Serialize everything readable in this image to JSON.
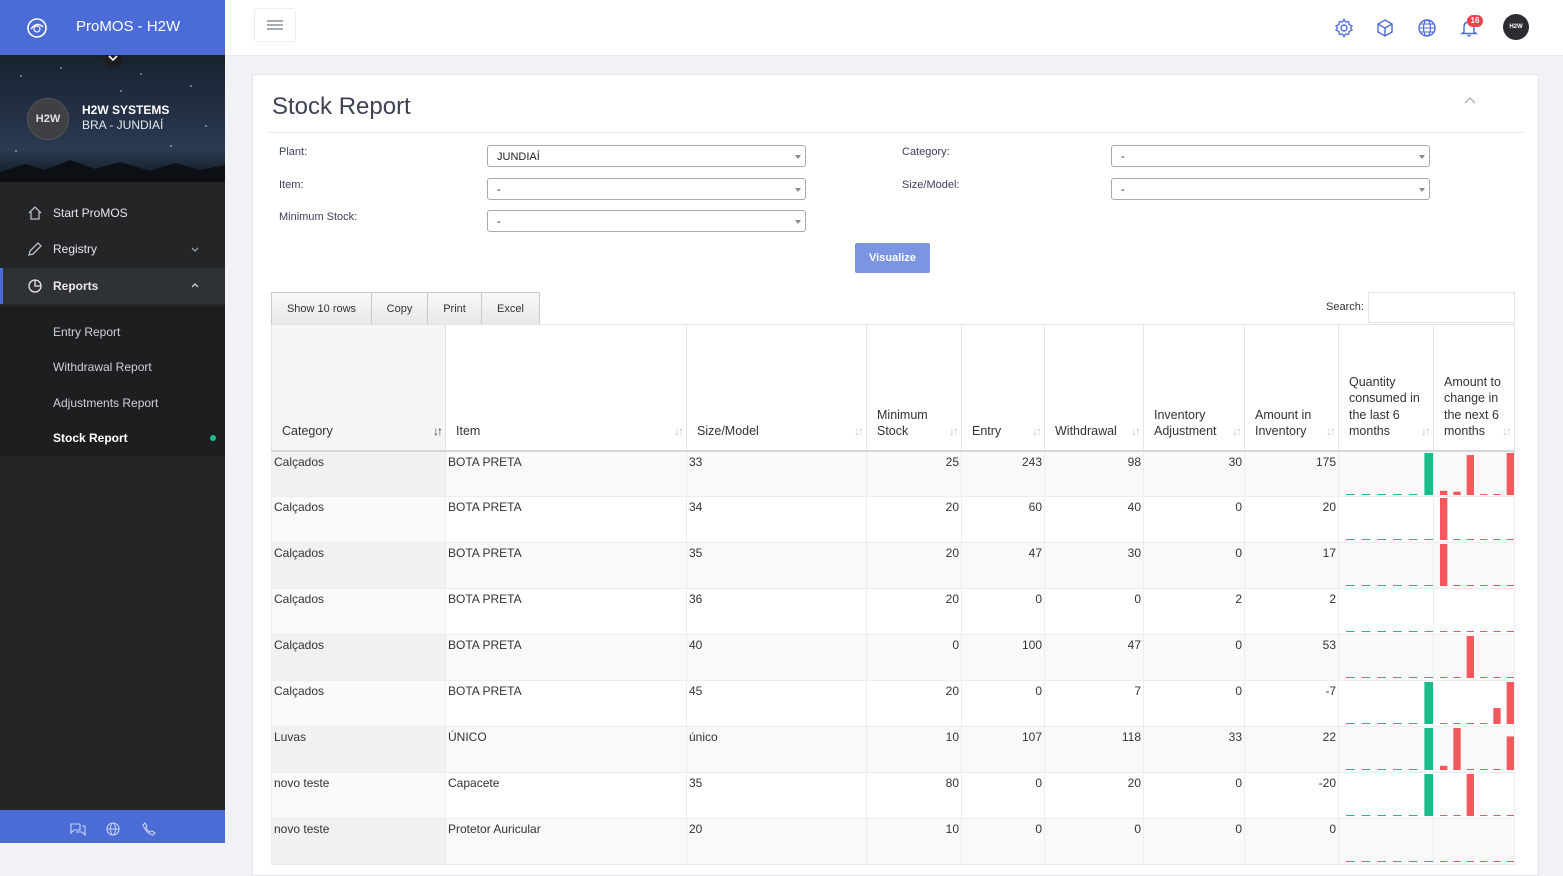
{
  "app": {
    "title": "ProMOS - H2W"
  },
  "profile": {
    "avatar": "H2W",
    "name": "H2W SYSTEMS",
    "location": "BRA - JUNDIAÍ"
  },
  "nav": {
    "start": "Start ProMOS",
    "registry": "Registry",
    "reports": "Reports",
    "submenu": [
      "Entry Report",
      "Withdrawal Report",
      "Adjustments Report",
      "Stock Report"
    ]
  },
  "topbar": {
    "notifications": "16",
    "avatar": "H2W"
  },
  "page": {
    "title": "Stock Report"
  },
  "filters": {
    "plant_label": "Plant:",
    "plant_value": "JUNDIAÍ",
    "category_label": "Category:",
    "category_value": "-",
    "item_label": "Item:",
    "item_value": "-",
    "size_label": "Size/Model:",
    "size_value": "-",
    "minstock_label": "Minimum Stock:",
    "minstock_value": "-",
    "visualize": "Visualize"
  },
  "toolbar": {
    "show_rows": "Show 10 rows",
    "copy": "Copy",
    "print": "Print",
    "excel": "Excel",
    "search_label": "Search:",
    "search_value": ""
  },
  "table": {
    "headers": [
      "Category",
      "Item",
      "Size/Model",
      "Minimum Stock",
      "Entry",
      "Withdrawal",
      "Inventory Adjustment",
      "Amount in Inventory",
      "Quantity consumed in the last 6 months",
      "Amount to change in the next 6 months"
    ],
    "rows": [
      [
        "Calçados",
        "BOTA PRETA",
        "33",
        "25",
        "243",
        "98",
        "30",
        "175"
      ],
      [
        "Calçados",
        "BOTA PRETA",
        "34",
        "20",
        "60",
        "40",
        "0",
        "20"
      ],
      [
        "Calçados",
        "BOTA PRETA",
        "35",
        "20",
        "47",
        "30",
        "0",
        "17"
      ],
      [
        "Calçados",
        "BOTA PRETA",
        "36",
        "20",
        "0",
        "0",
        "2",
        "2"
      ],
      [
        "Calçados",
        "BOTA PRETA",
        "40",
        "0",
        "100",
        "47",
        "0",
        "53"
      ],
      [
        "Calçados",
        "BOTA PRETA",
        "45",
        "20",
        "0",
        "7",
        "0",
        "-7"
      ],
      [
        "Luvas",
        "ÚNICO",
        "único",
        "10",
        "107",
        "118",
        "33",
        "22"
      ],
      [
        "novo teste",
        "Capacete",
        "35",
        "80",
        "0",
        "20",
        "0",
        "-20"
      ],
      [
        "novo teste",
        "Protetor Auricular",
        "20",
        "10",
        "0",
        "0",
        "0",
        "0"
      ]
    ],
    "consumed_sparklines": [
      [
        0,
        0,
        0,
        0,
        0,
        1
      ],
      [
        0,
        0,
        0,
        0,
        0,
        0
      ],
      [
        0,
        0,
        0,
        0,
        0,
        0
      ],
      [
        0,
        0,
        0,
        0,
        0,
        0
      ],
      [
        0,
        0,
        0,
        0,
        0,
        0
      ],
      [
        0,
        0,
        0,
        0,
        0,
        1
      ],
      [
        0,
        0,
        0,
        0,
        0,
        1
      ],
      [
        0,
        0,
        0,
        0,
        0,
        1
      ],
      [
        0,
        0,
        0,
        0,
        0,
        0
      ]
    ],
    "change_sparklines": [
      [
        0.1,
        0.08,
        0.95,
        0,
        0,
        1
      ],
      [
        1,
        0,
        0,
        0,
        0,
        0
      ],
      [
        1,
        0,
        0,
        0,
        0,
        0
      ],
      [
        0,
        0,
        0,
        0,
        0,
        0
      ],
      [
        0,
        0,
        1,
        0,
        0,
        0
      ],
      [
        0,
        0,
        0,
        0,
        0.38,
        1
      ],
      [
        0.1,
        1,
        0,
        0,
        0,
        0.8
      ],
      [
        0,
        0,
        1,
        0,
        0,
        0
      ],
      [
        0,
        0,
        0,
        0,
        0,
        0
      ]
    ]
  },
  "colors": {
    "accent": "#4b6bd6",
    "sidebar": "#232527",
    "consumed": "#1cbb8c",
    "change": "#f4585f"
  },
  "icons": [
    "home-icon",
    "pencil-icon",
    "pie-chart-icon",
    "gear-icon",
    "box-icon",
    "globe-icon",
    "bell-icon",
    "chat-icon",
    "phone-icon",
    "menu-icon"
  ]
}
